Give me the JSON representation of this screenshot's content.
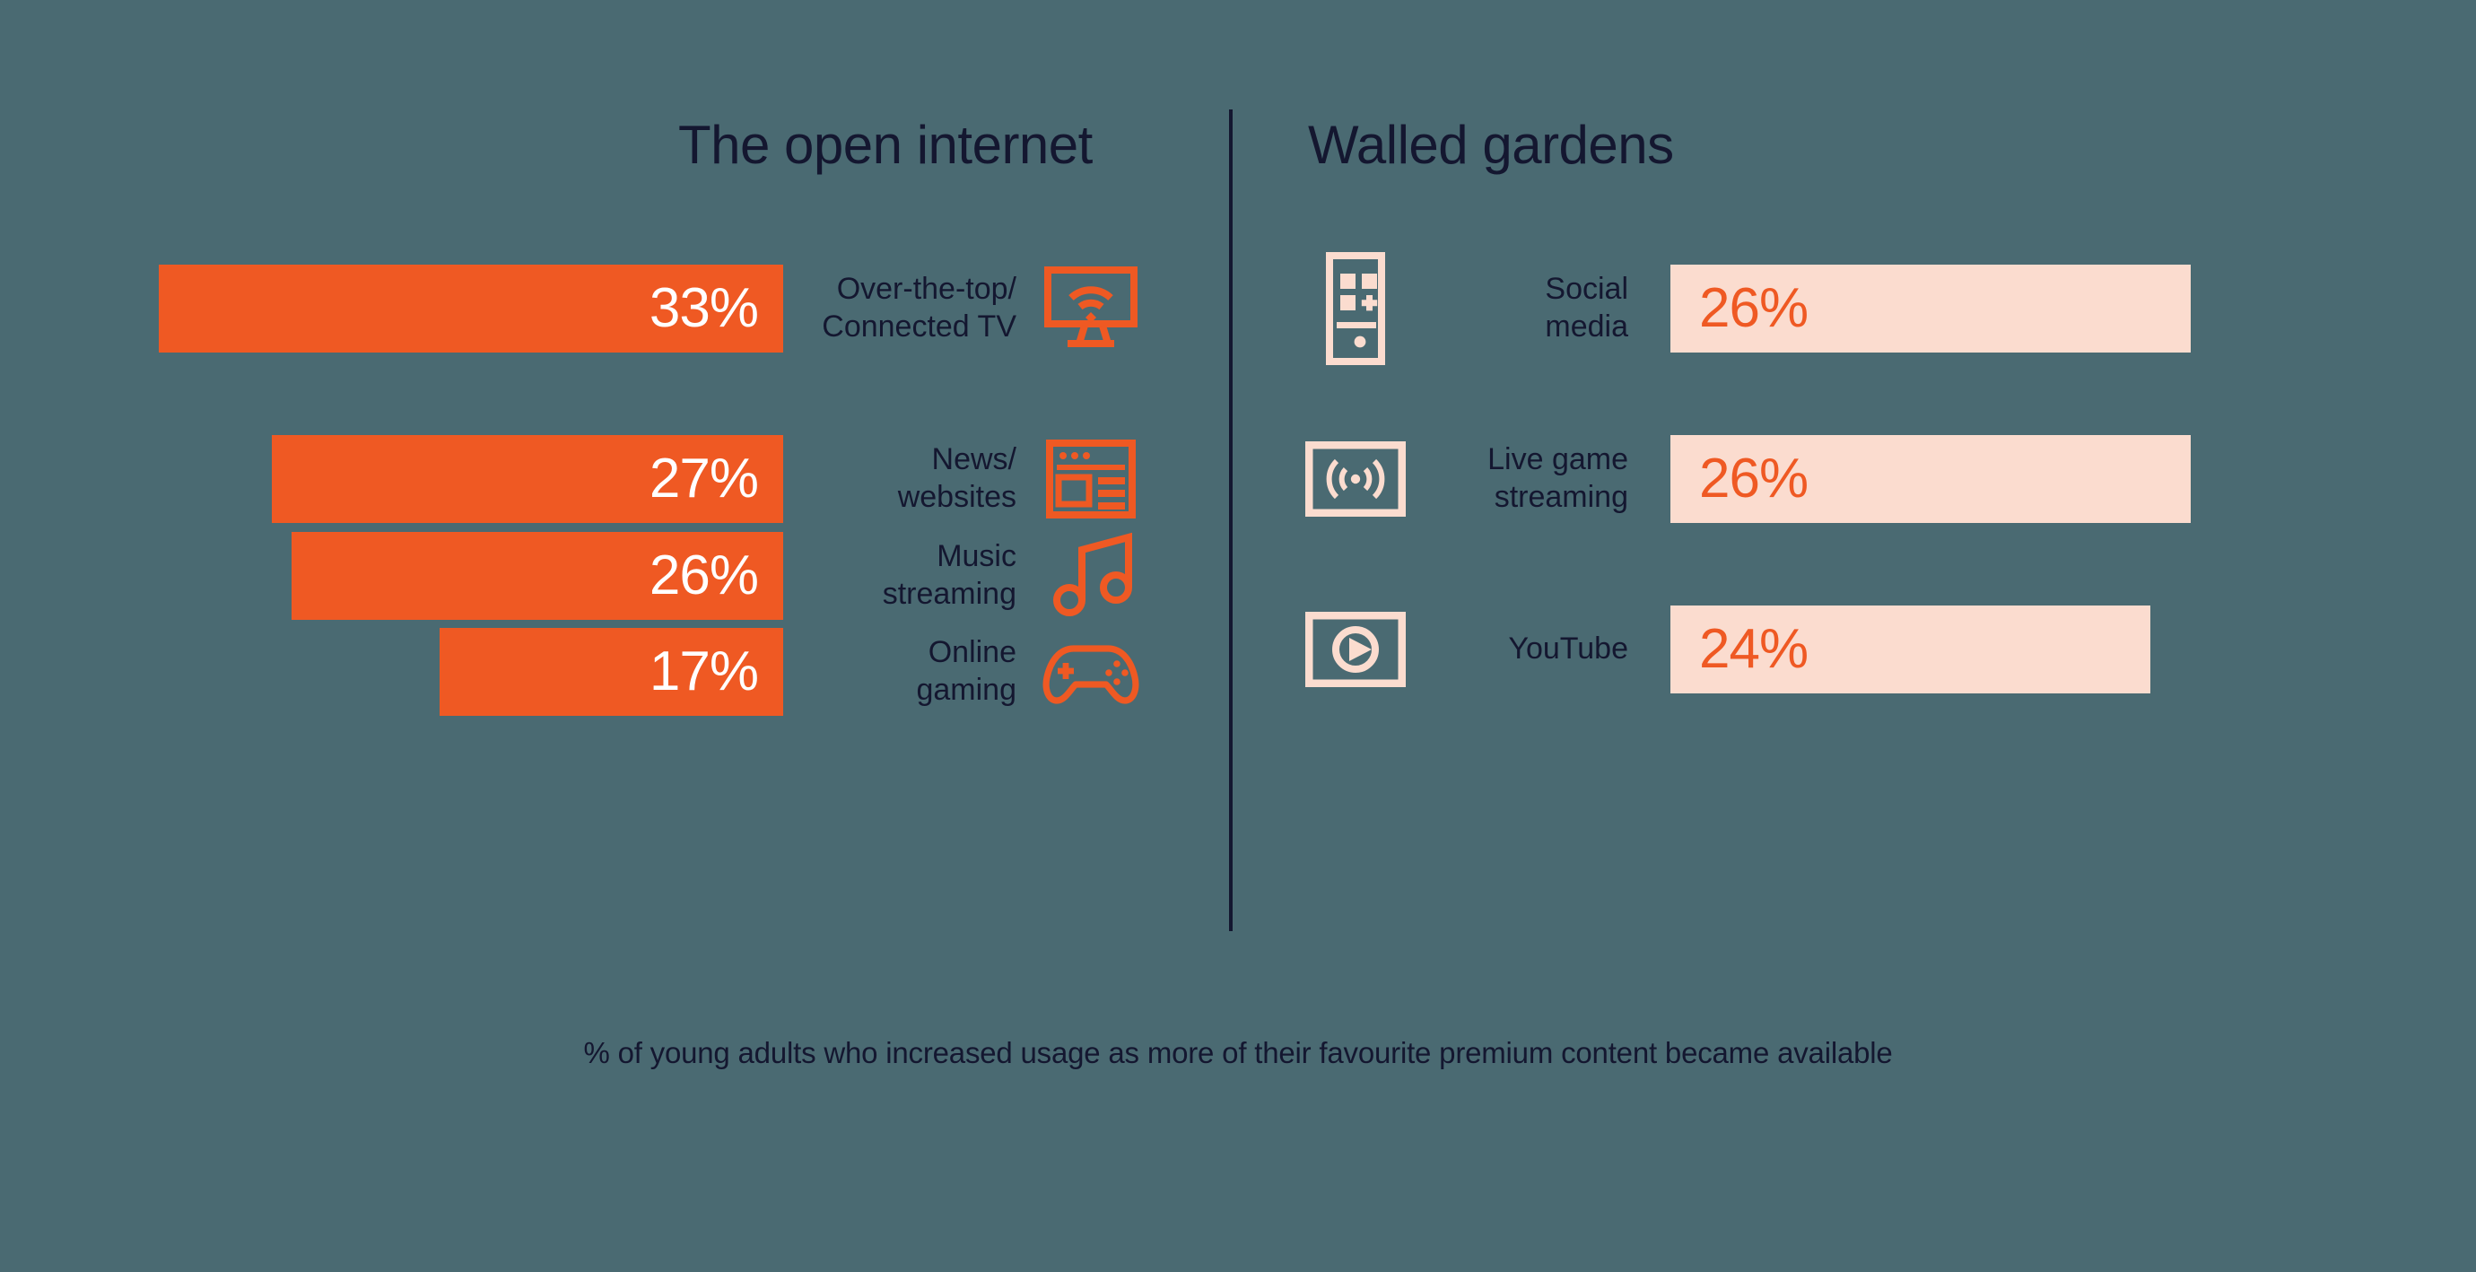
{
  "background_color": "#4a6a72",
  "colors": {
    "background": "#4a6a72",
    "bar_primary": "#ef5923",
    "bar_secondary": "#fbdccf",
    "text_dark": "#141730",
    "value_on_primary": "#ffffff",
    "value_on_secondary": "#ef5923"
  },
  "panels": {
    "left": {
      "heading": "The open internet"
    },
    "right": {
      "heading": "Walled gardens"
    }
  },
  "caption": "% of young adults who increased usage as more of their favourite premium content became available",
  "chart_data": {
    "type": "bar",
    "title": "",
    "subtitle": "",
    "xlabel": "",
    "ylabel": "",
    "annotation": "% of young adults who increased usage as more of their favourite premium content became available",
    "orientation": "horizontal",
    "grid": false,
    "legend": "none",
    "xlim": [
      0,
      33
    ],
    "unit": "%",
    "groups": [
      {
        "name": "The open internet",
        "bar_color": "#ef5923",
        "value_color": "#ffffff",
        "direction": "right-to-left",
        "categories": [
          "Over-the-top/ Connected TV",
          "News/ websites",
          "Music streaming",
          "Online gaming"
        ],
        "values": [
          33,
          27,
          26,
          17
        ],
        "value_labels": [
          "33%",
          "27%",
          "26%",
          "17%"
        ],
        "items": [
          {
            "label_line1": "Over-the-top/",
            "label_line2": "Connected TV",
            "value": 33,
            "value_label": "33%",
            "icon": "connected-tv-icon"
          },
          {
            "label_line1": "News/",
            "label_line2": "websites",
            "value": 27,
            "value_label": "27%",
            "icon": "browser-window-icon"
          },
          {
            "label_line1": "Music",
            "label_line2": "streaming",
            "value": 26,
            "value_label": "26%",
            "icon": "music-note-icon"
          },
          {
            "label_line1": "Online",
            "label_line2": "gaming",
            "value": 17,
            "value_label": "17%",
            "icon": "gamepad-icon"
          }
        ]
      },
      {
        "name": "Walled gardens",
        "bar_color": "#fbdccf",
        "value_color": "#ef5923",
        "direction": "left-to-right",
        "categories": [
          "Social media",
          "Live game streaming",
          "YouTube"
        ],
        "values": [
          26,
          26,
          24
        ],
        "value_labels": [
          "26%",
          "26%",
          "24%"
        ],
        "items": [
          {
            "label_line1": "Social",
            "label_line2": "media",
            "value": 26,
            "value_label": "26%",
            "icon": "smartphone-apps-icon"
          },
          {
            "label_line1": "Live game",
            "label_line2": "streaming",
            "value": 26,
            "value_label": "26%",
            "icon": "live-broadcast-icon"
          },
          {
            "label_line1": "YouTube",
            "label_line2": "",
            "value": 24,
            "value_label": "24%",
            "icon": "video-play-icon"
          }
        ]
      }
    ]
  }
}
